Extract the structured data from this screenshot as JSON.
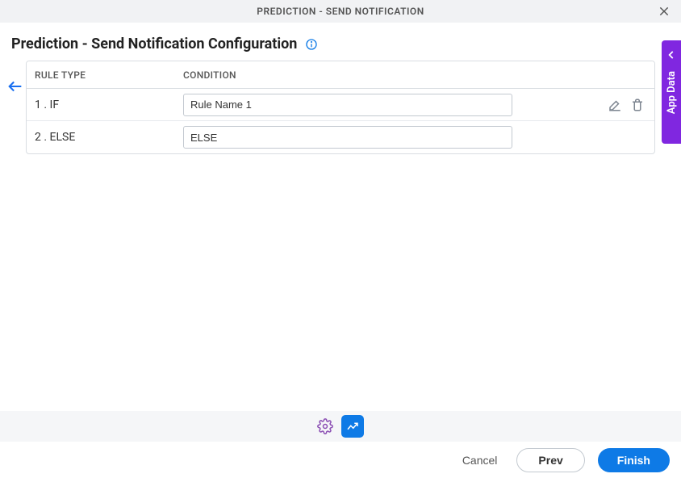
{
  "header": {
    "title": "PREDICTION - SEND NOTIFICATION"
  },
  "page": {
    "title": "Prediction - Send Notification Configuration"
  },
  "table": {
    "headers": {
      "rule_type": "RULE TYPE",
      "condition": "CONDITION"
    },
    "rows": [
      {
        "rule_type": "1 . IF",
        "condition": "Rule Name 1",
        "show_actions": true
      },
      {
        "rule_type": "2 . ELSE",
        "condition": "ELSE",
        "show_actions": false
      }
    ]
  },
  "side_tab": {
    "label": "App Data"
  },
  "footer": {
    "cancel": "Cancel",
    "prev": "Prev",
    "finish": "Finish"
  }
}
